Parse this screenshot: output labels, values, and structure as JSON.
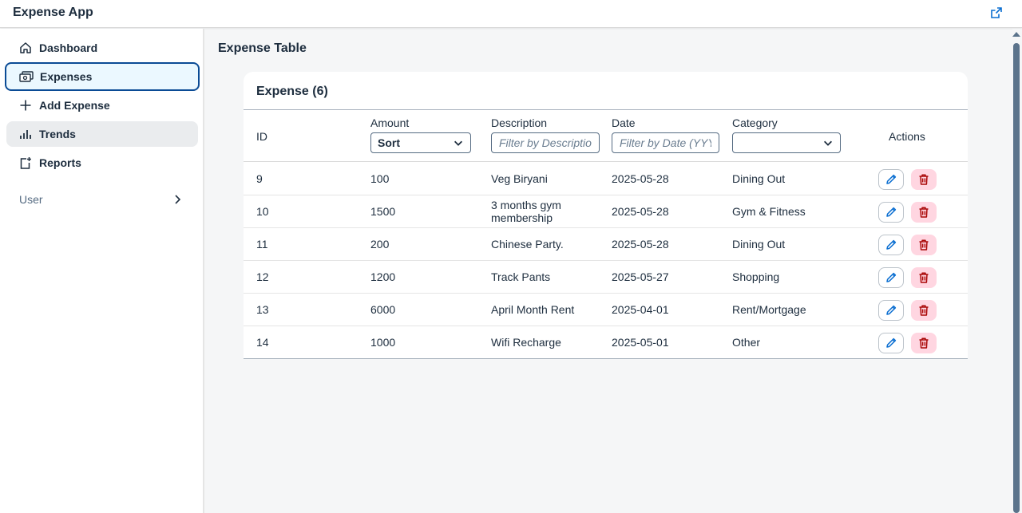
{
  "app": {
    "title": "Expense App"
  },
  "header": {
    "share_icon": "share-icon"
  },
  "sidebar": {
    "items": [
      {
        "label": "Dashboard",
        "icon": "home-icon"
      },
      {
        "label": "Expenses",
        "icon": "money-bills-icon"
      },
      {
        "label": "Add Expense",
        "icon": "add-icon"
      },
      {
        "label": "Trends",
        "icon": "bar-chart-icon"
      },
      {
        "label": "Reports",
        "icon": "document-add-icon"
      }
    ],
    "user_group": {
      "label": "User"
    }
  },
  "page": {
    "title": "Expense Table"
  },
  "table": {
    "title": "Expense (6)",
    "columns": {
      "id": "ID",
      "amount": "Amount",
      "description": "Description",
      "date": "Date",
      "category": "Category",
      "actions": "Actions"
    },
    "sort_label": "Sort",
    "description_filter_placeholder": "Filter by Description",
    "date_filter_placeholder": "Filter by Date (YYYY-MM-DD)",
    "category_selected": "",
    "rows": [
      {
        "id": "9",
        "amount": "100",
        "description": "Veg Biryani",
        "date": "2025-05-28",
        "category": "Dining Out"
      },
      {
        "id": "10",
        "amount": "1500",
        "description": "3 months gym membership",
        "date": "2025-05-28",
        "category": "Gym & Fitness"
      },
      {
        "id": "11",
        "amount": "200",
        "description": "Chinese Party.",
        "date": "2025-05-28",
        "category": "Dining Out"
      },
      {
        "id": "12",
        "amount": "1200",
        "description": "Track Pants",
        "date": "2025-05-27",
        "category": "Shopping"
      },
      {
        "id": "13",
        "amount": "6000",
        "description": "April Month Rent",
        "date": "2025-04-01",
        "category": "Rent/Mortgage"
      },
      {
        "id": "14",
        "amount": "1000",
        "description": "Wifi Recharge",
        "date": "2025-05-01",
        "category": "Other"
      }
    ]
  },
  "colors": {
    "accent": "#0a6ed1",
    "selected_border": "#0a4b95",
    "delete_bg": "#ffd6e1",
    "delete_icon": "#aa0808"
  }
}
